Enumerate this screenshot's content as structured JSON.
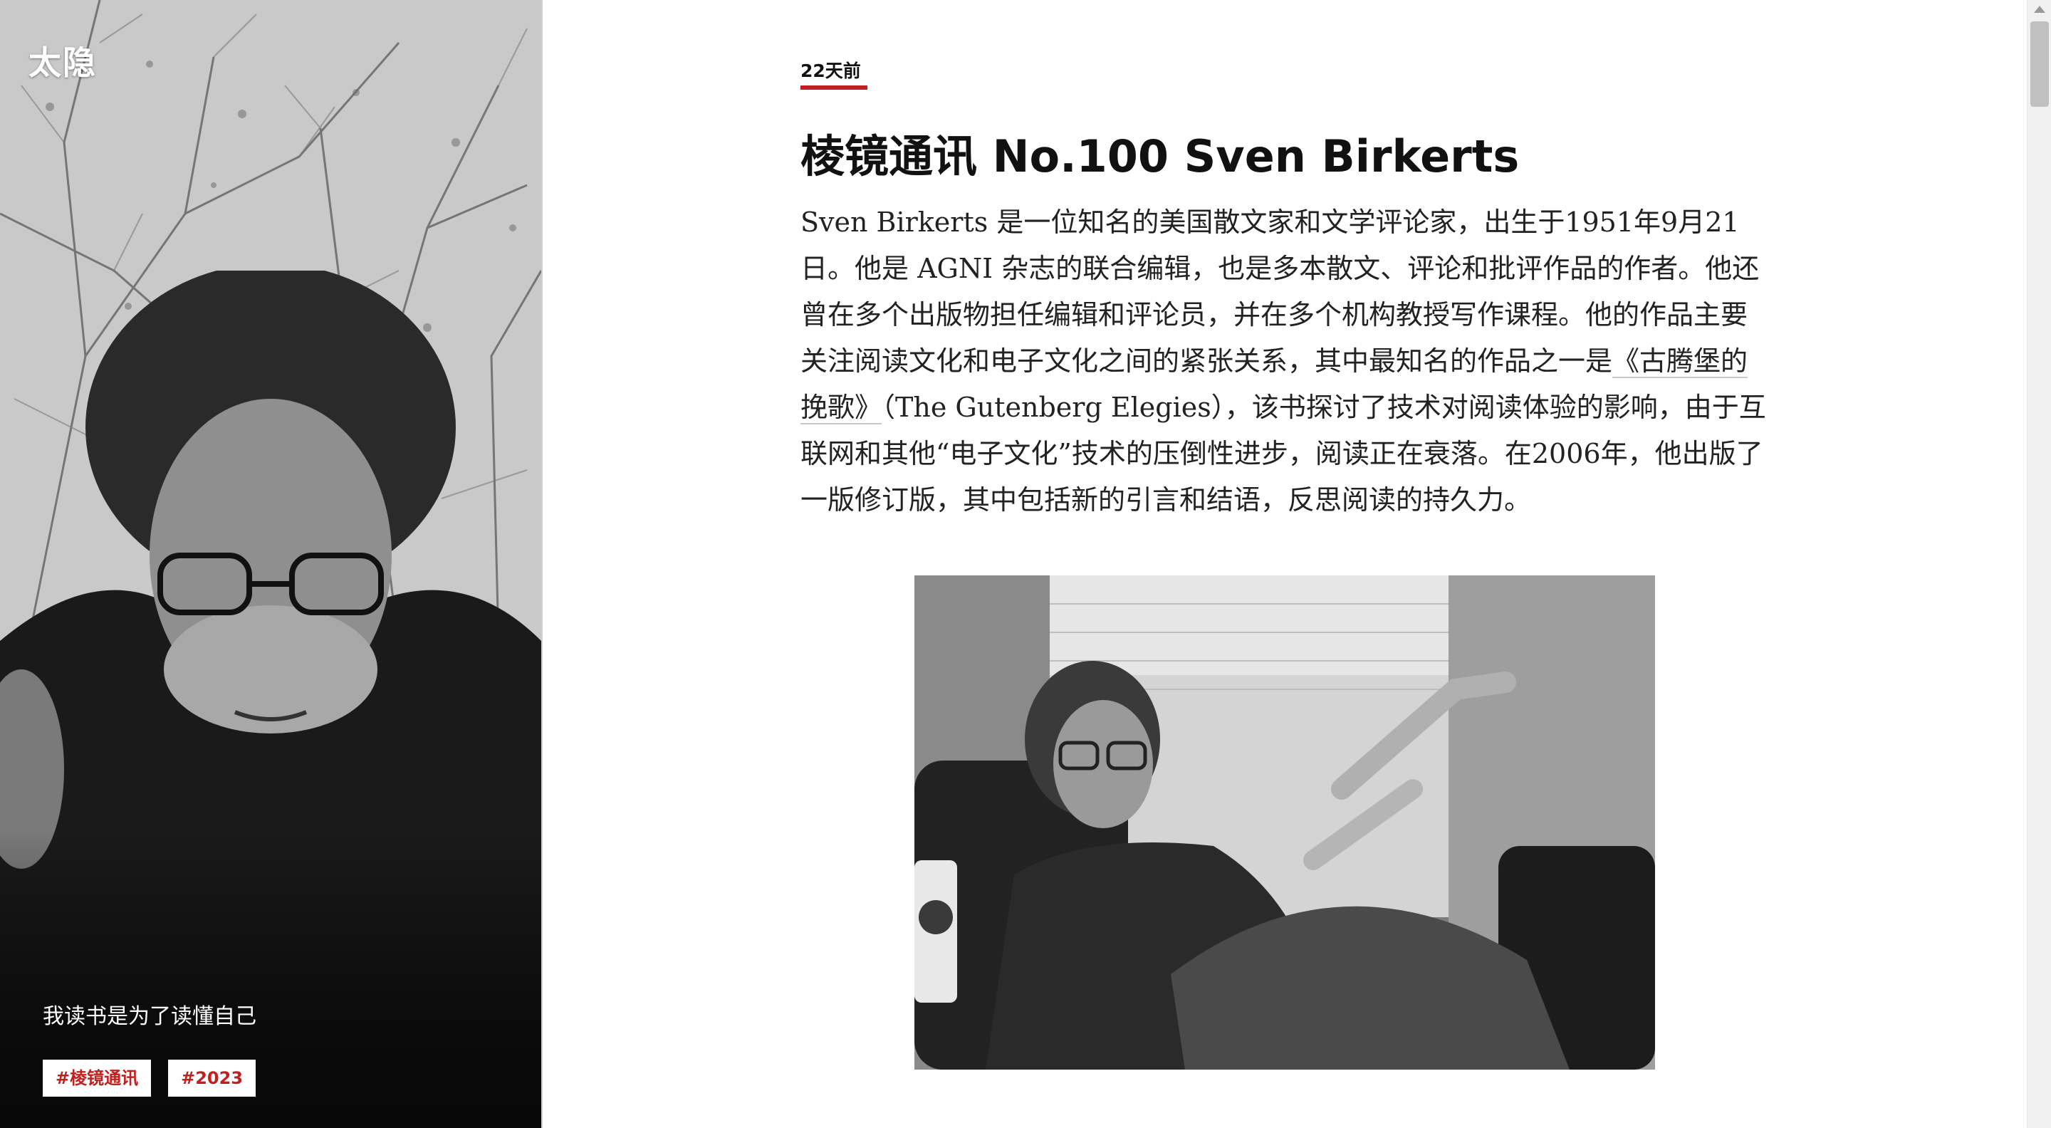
{
  "site": {
    "title": "太隐",
    "tagline": "我读书是为了读懂自己",
    "tags": [
      "#棱镜通讯",
      "#2023"
    ]
  },
  "article": {
    "date": "22天前",
    "title": "棱镜通讯 No.100 Sven Birkerts",
    "paragraph": {
      "part1": "Sven Birkerts 是一位知名的美国散文家和文学评论家，出生于1951年9月21日。他是 AGNI 杂志的联合编辑，也是多本散文、评论和批评作品的作者。他还曾在多个出版物担任编辑和评论员，并在多个机构教授写作课程。他的作品主要关注阅读文化和电子文化之间的紧张关系，其中最知名的作品之一是",
      "link": "《古腾堡的挽歌》",
      "part2": "（The Gutenberg Elegies），该书探讨了技术对阅读体验的影响，由于互联网和其他“电子文化”技术的压倒性进步，阅读正在衰落。在2006年，他出版了一版修订版，其中包括新的引言和结语，反思阅读的持久力。"
    }
  },
  "colors": {
    "accent": "#c0211f",
    "text": "#222222",
    "background": "#ffffff"
  }
}
